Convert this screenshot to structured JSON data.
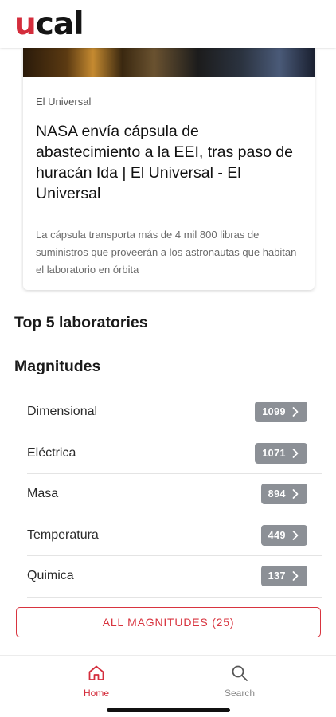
{
  "header": {
    "logo_u": "u",
    "logo_rest": "cal"
  },
  "news_card": {
    "source": "El Universal",
    "title": "NASA envía cápsula de abastecimiento a la EEI, tras paso de huracán Ida | El Universal - El Universal",
    "summary": "La cápsula transporta más de 4 mil 800 libras de suministros que proveerán a los astronautas que habitan el laboratorio en órbita"
  },
  "sections": {
    "top5_title": "Top 5 laboratories",
    "magnitudes_title": "Magnitudes"
  },
  "magnitudes": [
    {
      "label": "Dimensional",
      "count": "1099"
    },
    {
      "label": "Eléctrica",
      "count": "1071"
    },
    {
      "label": "Masa",
      "count": "894"
    },
    {
      "label": "Temperatura",
      "count": "449"
    },
    {
      "label": "Quimica",
      "count": "137"
    }
  ],
  "all_magnitudes_button": "ALL MAGNITUDES (25)",
  "bottom_nav": {
    "home_label": "Home",
    "search_label": "Search"
  },
  "colors": {
    "accent": "#d42d3c",
    "badge": "#8c9096"
  },
  "icons": {
    "badge_chevron": "chevron-right-icon",
    "home": "home-icon",
    "search": "search-icon"
  }
}
